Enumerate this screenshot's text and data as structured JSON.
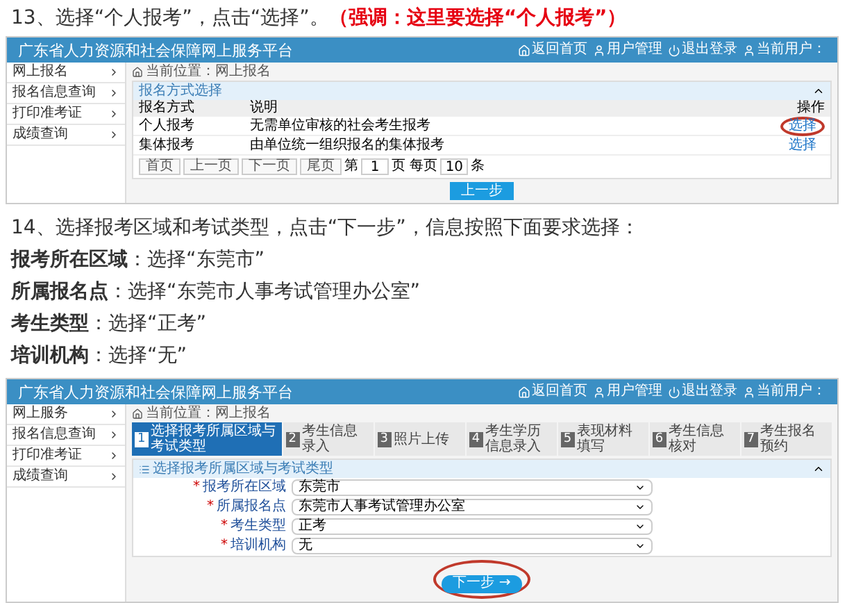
{
  "step13": {
    "text": "13、选择“个人报考”，点击“选择”。",
    "emphasis": "（强调：这里要选择“个人报考”）"
  },
  "screen1": {
    "title": "广东省人力资源和社会保障网上服务平台",
    "header_links": [
      "返回首页",
      "用户管理",
      "退出登录",
      "当前用户："
    ],
    "sidebar": [
      "网上报名",
      "报名信息查询",
      "打印准考证",
      "成绩查询"
    ],
    "breadcrumb": "当前位置：网上报名",
    "panel_title": "报名方式选择",
    "columns": [
      "报名方式",
      "说明",
      "操作"
    ],
    "rows": [
      {
        "method": "个人报考",
        "description": "无需单位审核的社会考生报考",
        "action": "选择",
        "circled": true
      },
      {
        "method": "集体报考",
        "description": "由单位统一组织报名的集体报考",
        "action": "选择",
        "circled": false
      }
    ],
    "pagination": {
      "buttons": [
        "首页",
        "上一页",
        "下一页",
        "尾页"
      ],
      "page_prefix": "第",
      "page": "1",
      "page_suffix": "页 每页",
      "per_page": "10",
      "per_page_suffix": "条"
    },
    "back_button": "上一步"
  },
  "step14": "14、选择报考区域和考试类型，点击“下一步”，信息按照下面要求选择：",
  "requirements": [
    "**报考所在区域**：选择“东莞市”",
    "**所属报名点**：选择“东莞市人事考试管理办公室”",
    "**考生类型**：选择“正考”",
    "**培训机构**：选择“无”"
  ],
  "screen2": {
    "title": "广东省人力资源和社会保障网上服务平台",
    "header_links": [
      "返回首页",
      "用户管理",
      "退出登录",
      "当前用户："
    ],
    "sidebar": [
      "网上服务",
      "报名信息查询",
      "打印准考证",
      "成绩查询"
    ],
    "breadcrumb": "当前位置：网上报名",
    "steps": [
      {
        "number": "1",
        "label": "选择报考所属区域与考试类型",
        "selected": true
      },
      {
        "number": "2",
        "label": "考生信息录入",
        "selected": false
      },
      {
        "number": "3",
        "label": "照片上传",
        "selected": false
      },
      {
        "number": "4",
        "label": "考生学历信息录入",
        "selected": false
      },
      {
        "number": "5",
        "label": "表现材料填写",
        "selected": false
      },
      {
        "number": "6",
        "label": "考生信息核对",
        "selected": false
      },
      {
        "number": "7",
        "label": "考生报名预约",
        "selected": false
      }
    ],
    "panel_title": "选择报考所属区域与考试类型",
    "fields": [
      {
        "mark": "*",
        "label": "报考所在区域",
        "value": "东莞市"
      },
      {
        "mark": "*",
        "label": "所属报名点",
        "value": "东莞市人事考试管理办公室"
      },
      {
        "mark": "*",
        "label": "考生类型",
        "value": "正考"
      },
      {
        "mark": "*",
        "label": "培训机构",
        "value": "无"
      }
    ],
    "next_button": {
      "label": "下一步 →",
      "circled": true
    }
  }
}
